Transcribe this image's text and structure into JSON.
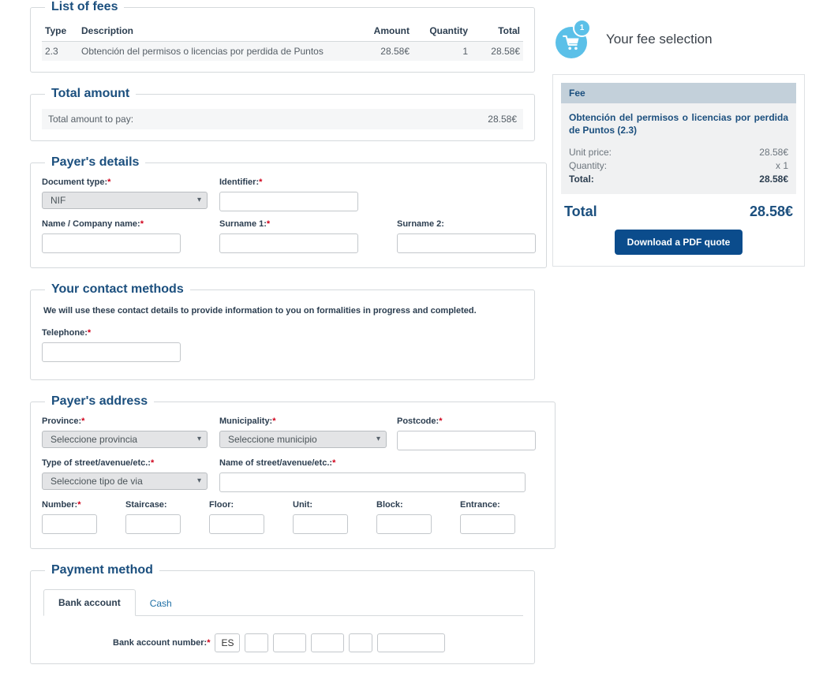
{
  "fees_panel": {
    "legend": "List of fees",
    "columns": [
      "Type",
      "Description",
      "Amount",
      "Quantity",
      "Total"
    ],
    "rows": [
      {
        "type": "2.3",
        "description": "Obtención del permisos o licencias por perdida de Puntos",
        "amount": "28.58€",
        "quantity": "1",
        "total": "28.58€"
      }
    ]
  },
  "total_panel": {
    "legend": "Total amount",
    "label": "Total amount to pay:",
    "value": "28.58€"
  },
  "payer_details": {
    "legend": "Payer's details",
    "document_type_label": "Document type:",
    "document_type_value": "NIF",
    "identifier_label": "Identifier:",
    "identifier_value": "",
    "name_label": "Name / Company name:",
    "name_value": "",
    "surname1_label": "Surname 1:",
    "surname1_value": "",
    "surname2_label": "Surname 2:",
    "surname2_value": ""
  },
  "contact": {
    "legend": "Your contact methods",
    "note": "We will use these contact details to provide information to you on formalities in progress and completed.",
    "telephone_label": "Telephone:",
    "telephone_value": ""
  },
  "address": {
    "legend": "Payer's address",
    "province_label": "Province:",
    "province_value": "Seleccione provincia",
    "municipality_label": "Municipality:",
    "municipality_value": "Seleccione municipio",
    "postcode_label": "Postcode:",
    "postcode_value": "",
    "street_type_label": "Type of street/avenue/etc.:",
    "street_type_value": "Seleccione tipo de via",
    "street_name_label": "Name of street/avenue/etc.:",
    "street_name_value": "",
    "number_label": "Number:",
    "number_value": "",
    "staircase_label": "Staircase:",
    "staircase_value": "",
    "floor_label": "Floor:",
    "floor_value": "",
    "unit_label": "Unit:",
    "unit_value": "",
    "block_label": "Block:",
    "block_value": "",
    "entrance_label": "Entrance:",
    "entrance_value": ""
  },
  "payment": {
    "legend": "Payment method",
    "tab_bank": "Bank account",
    "tab_cash": "Cash",
    "bank_label": "Bank account number:",
    "iban_prefix": "ES",
    "seg1": "",
    "seg2": "",
    "seg3": "",
    "seg4": "",
    "seg5": ""
  },
  "sidebar": {
    "cart_badge": "1",
    "title": "Your fee selection",
    "fee_header": "Fee",
    "fee_name": "Obtención del permisos o licencias por perdida de Puntos (2.3)",
    "unit_price_label": "Unit price:",
    "unit_price_value": "28.58€",
    "quantity_label": "Quantity:",
    "quantity_value": "x 1",
    "line_total_label": "Total:",
    "line_total_value": "28.58€",
    "grand_total_label": "Total",
    "grand_total_value": "28.58€",
    "download_button": "Download a PDF quote"
  },
  "colors": {
    "heading_blue": "#1b4f7e",
    "required_red": "#d0021b",
    "cart_blue": "#5bc0e8",
    "button_blue": "#0b4c8c",
    "fee_header_band": "#c3d0da"
  },
  "icons": {
    "chevron": "˅",
    "cart": "shopping-cart-icon"
  }
}
